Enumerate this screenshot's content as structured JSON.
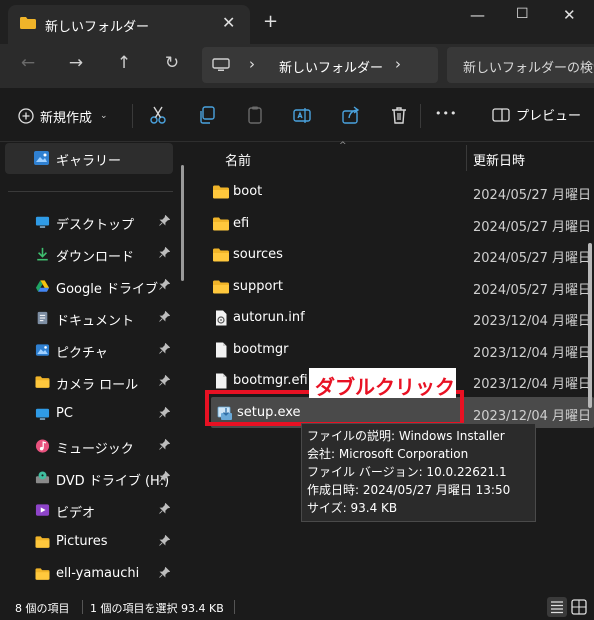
{
  "window": {
    "tab_title": "新しいフォルダー",
    "tab_close": "✕",
    "new_tab": "+",
    "minimize": "—",
    "maximize": "☐",
    "close": "✕"
  },
  "nav": {
    "back": "←",
    "forward": "→",
    "up": "↑",
    "refresh": "↻",
    "address_chevron": "›",
    "address_path": "新しいフォルダー",
    "search_placeholder": "新しいフォルダーの検索"
  },
  "toolbar": {
    "new_label": "新規作成",
    "new_chevron": "⌄",
    "preview_label": "プレビュー",
    "more": "•••"
  },
  "sidebar": {
    "selected": {
      "label": "ギャラリー",
      "icon": "gallery-icon"
    },
    "items": [
      {
        "label": "デスクトップ",
        "icon": "desktop-icon",
        "pinned": true
      },
      {
        "label": "ダウンロード",
        "icon": "download-icon",
        "pinned": true
      },
      {
        "label": "Google ドライブ",
        "icon": "google-drive-icon",
        "pinned": true
      },
      {
        "label": "ドキュメント",
        "icon": "documents-icon",
        "pinned": true
      },
      {
        "label": "ピクチャ",
        "icon": "pictures-icon",
        "pinned": true
      },
      {
        "label": "カメラ ロール",
        "icon": "folder-icon",
        "pinned": true
      },
      {
        "label": "PC",
        "icon": "pc-icon",
        "pinned": true
      },
      {
        "label": "ミュージック",
        "icon": "music-icon",
        "pinned": true
      },
      {
        "label": "DVD ドライブ (H:)",
        "icon": "dvd-icon",
        "pinned": true
      },
      {
        "label": "ビデオ",
        "icon": "video-icon",
        "pinned": true
      },
      {
        "label": "Pictures",
        "icon": "folder-icon",
        "pinned": true
      },
      {
        "label": "ell-yamauchi",
        "icon": "folder-icon",
        "pinned": true
      }
    ],
    "pin_glyph": "📌"
  },
  "columns": {
    "name": "名前",
    "modified": "更新日時"
  },
  "files": [
    {
      "name": "boot",
      "date": "2024/05/27 月曜日",
      "icon": "folder-icon"
    },
    {
      "name": "efi",
      "date": "2024/05/27 月曜日",
      "icon": "folder-icon"
    },
    {
      "name": "sources",
      "date": "2024/05/27 月曜日",
      "icon": "folder-icon"
    },
    {
      "name": "support",
      "date": "2024/05/27 月曜日",
      "icon": "folder-icon"
    },
    {
      "name": "autorun.inf",
      "date": "2023/12/04 月曜日",
      "icon": "settings-file-icon"
    },
    {
      "name": "bootmgr",
      "date": "2023/12/04 月曜日",
      "icon": "file-icon"
    },
    {
      "name": "bootmgr.efi",
      "date": "2023/12/04 月曜日",
      "icon": "file-icon"
    },
    {
      "name": "setup.exe",
      "date": "2023/12/04 月曜日",
      "icon": "installer-icon",
      "selected": true
    }
  ],
  "annotation": {
    "text": "ダブルクリック",
    "color": "#e81123"
  },
  "tooltip": {
    "lines": [
      "ファイルの説明: Windows Installer",
      "会社: Microsoft Corporation",
      "ファイル バージョン: 10.0.22621.1",
      "作成日時: 2024/05/27 月曜日 13:50",
      "サイズ: 93.4 KB"
    ]
  },
  "status": {
    "item_count": "8 個の項目",
    "selection": "1 個の項目を選択  93.4 KB"
  },
  "colors": {
    "folder": "#f0b429",
    "accent": "#4aa3df",
    "highlight": "#e81123"
  }
}
